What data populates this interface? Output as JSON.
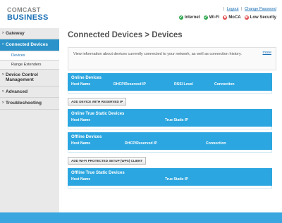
{
  "brand": {
    "line1": "COMCAST",
    "line2": "BUSINESS"
  },
  "top_links": {
    "logout": "Logout",
    "separator": "|",
    "change_password": "Change Password"
  },
  "status": [
    {
      "label": "Internet",
      "state": "ok",
      "icon": "check-icon"
    },
    {
      "label": "Wi-Fi",
      "state": "ok",
      "icon": "check-icon"
    },
    {
      "label": "MoCA",
      "state": "bad",
      "icon": "x-icon"
    },
    {
      "label": "Low Security",
      "state": "bad",
      "icon": "x-icon"
    }
  ],
  "status_glyphs": {
    "ok": "✔",
    "bad": "✖"
  },
  "sidebar": {
    "gateway": "Gateway",
    "connected_devices": "Connected Devices",
    "sub_devices": "Devices",
    "sub_range_extenders": "Range Extenders",
    "device_control": "Device Control Management",
    "advanced": "Advanced",
    "troubleshooting": "Troubleshooting"
  },
  "page_title": "Connected Devices > Devices",
  "info": {
    "text": "View information about devices currently connected to your network, as well as connection history.",
    "more": "more"
  },
  "panels": {
    "online": {
      "title": "Online Devices",
      "cols": [
        "Host Name",
        "DHCP/Reserved IP",
        "RSSI Level",
        "Connection"
      ]
    },
    "online_static": {
      "title": "Online True Static Devices",
      "cols": [
        "Host Name",
        "True Static IP"
      ]
    },
    "offline": {
      "title": "Offline Devices",
      "cols": [
        "Host Name",
        "DHCP/Reserved IP",
        "Connection"
      ]
    },
    "offline_static": {
      "title": "Offline True Static Devices",
      "cols": [
        "Host Name",
        "True Static IP"
      ]
    }
  },
  "buttons": {
    "add_reserved": "ADD DEVICE WITH RESERVED IP",
    "add_wps": "ADD WI-FI PROTECTED SETUP (WPS) CLIENT"
  },
  "colors": {
    "accent": "#2ba6e0",
    "brand": "#1a6fb5",
    "ok": "#2fa84f",
    "bad": "#e04646",
    "sidebar_active": "#2b93c9"
  }
}
